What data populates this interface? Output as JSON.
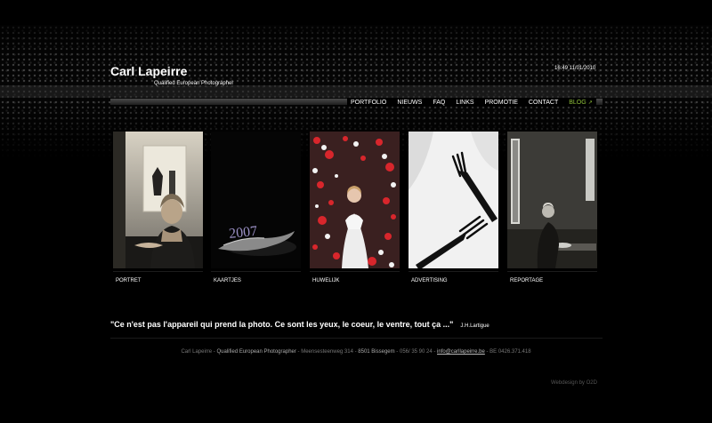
{
  "header": {
    "title": "Carl Lapeirre",
    "subtitle": "Qualified European Photographer",
    "datetime": "16:49 11/01/2010"
  },
  "nav": {
    "items": [
      "PORTFOLIO",
      "NIEUWS",
      "FAQ",
      "LINKS",
      "PROMOTIE",
      "CONTACT"
    ],
    "blog_label": "BLOG",
    "blog_icon": "external-link-icon",
    "blog_color": "#8fbf3a"
  },
  "gallery": {
    "tiles": [
      {
        "label": "PORTRET"
      },
      {
        "label": "KAARTJES",
        "image_text": "2007"
      },
      {
        "label": "HUWELIJK"
      },
      {
        "label": "ADVERTISING"
      },
      {
        "label": "REPORTAGE"
      }
    ]
  },
  "quote": {
    "text": "\"Ce n'est pas l'appareil qui prend la photo. Ce sont les yeux, le coeur, le ventre, tout ça ...\"",
    "author": "J.H.Lartigue"
  },
  "footer": {
    "name": "Carl Lapeirre",
    "dash": " - ",
    "title": "Qualified European Photographer",
    "street": "Meensesteenweg 314",
    "city": "8501 Bissegem",
    "phone": "056/ 35 90 24",
    "email": "info@carllapeirre.be",
    "btw": "BE 0426.371.418"
  },
  "credit": "Webdesign by O2D"
}
